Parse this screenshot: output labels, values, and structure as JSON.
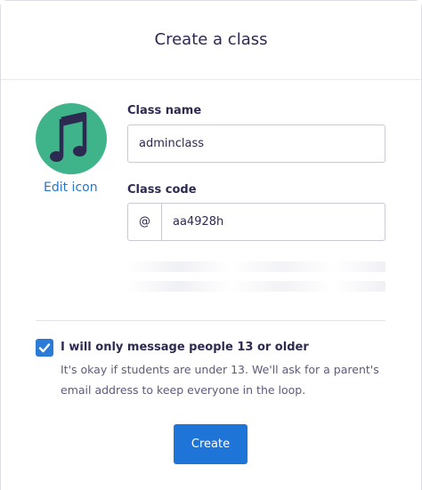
{
  "dialog": {
    "title": "Create a class"
  },
  "avatar": {
    "icon": "music-note-icon",
    "color": "#3fb389",
    "edit_label": "Edit icon"
  },
  "class_name": {
    "label": "Class name",
    "value": "adminclass"
  },
  "class_code": {
    "label": "Class code",
    "prefix": "@",
    "value": "aa4928h"
  },
  "age_confirm": {
    "checked": true,
    "title": "I will only message people 13 or older",
    "description": "It's okay if students are under 13. We'll ask for a parent's email address to keep everyone in the loop."
  },
  "actions": {
    "create_label": "Create",
    "accent": "#1f74d8"
  }
}
